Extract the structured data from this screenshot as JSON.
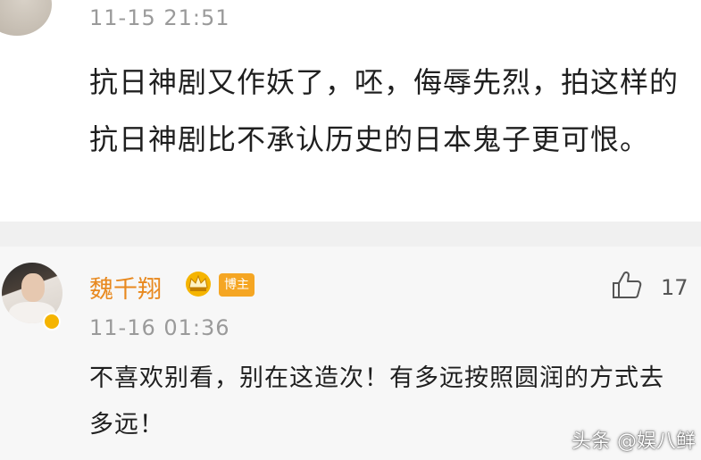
{
  "comment1": {
    "time": "11-15 21:51",
    "text": "抗日神剧又作妖了，呸，侮辱先烈，拍这样的抗日神剧比不承认历史的日本鬼子更可恨。"
  },
  "comment2": {
    "author": "魏千翔",
    "author_badge": "博主",
    "likes": "17",
    "time": "11-16 01:36",
    "text": "不喜欢别看，别在这造次！有多远按照圆润的方式去多远！"
  },
  "watermark": "头条 @娱八鲜",
  "icons": [
    "crown-icon",
    "thumbs-up-icon",
    "verified-badge-icon"
  ],
  "colors": {
    "author_name": "#e8891f",
    "badge": "#f5a623"
  }
}
